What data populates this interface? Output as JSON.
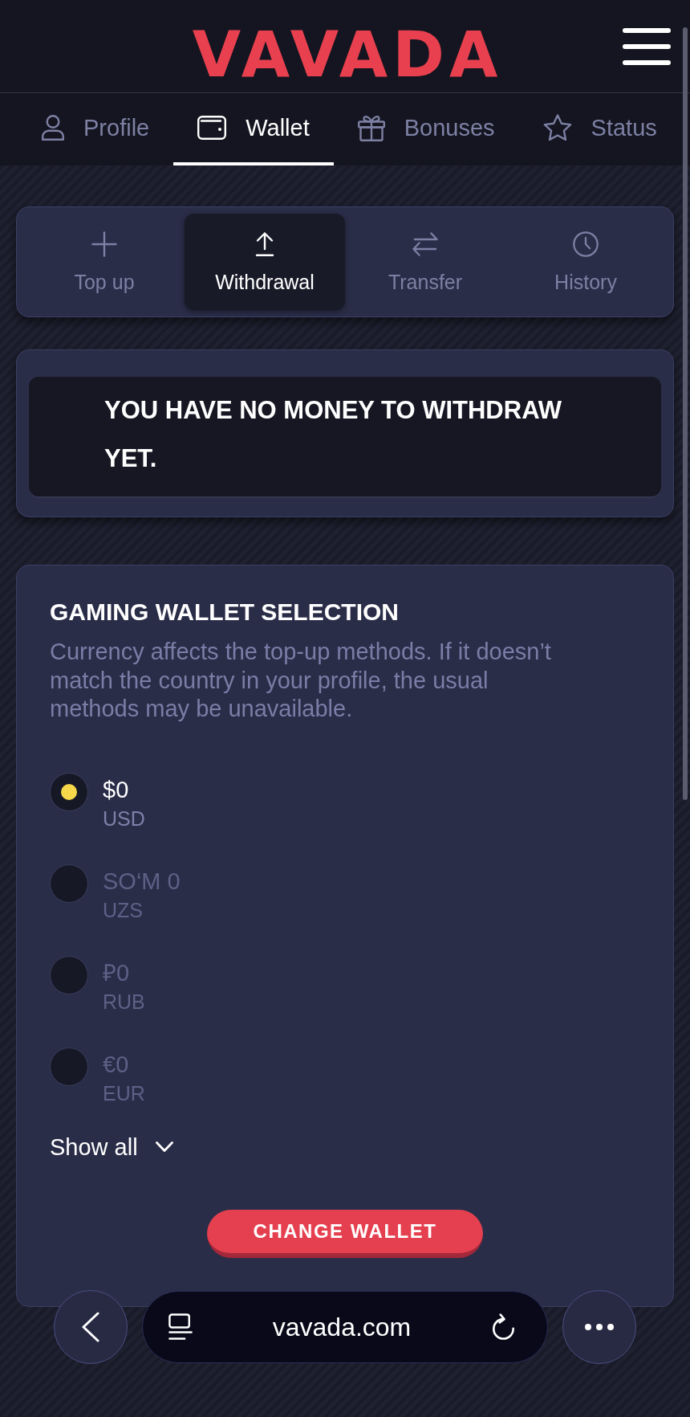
{
  "header": {
    "logo": "VAVADA"
  },
  "nav_tabs": [
    {
      "label": "Profile",
      "selected": false
    },
    {
      "label": "Wallet",
      "selected": true
    },
    {
      "label": "Bonuses",
      "selected": false
    },
    {
      "label": "Status",
      "selected": false
    }
  ],
  "wallet_actions": [
    {
      "label": "Top up",
      "selected": false
    },
    {
      "label": "Withdrawal",
      "selected": true
    },
    {
      "label": "Transfer",
      "selected": false
    },
    {
      "label": "History",
      "selected": false
    }
  ],
  "notice": {
    "message": "YOU HAVE NO MONEY TO WITHDRAW YET."
  },
  "wallet_selection": {
    "title": "GAMING WALLET SELECTION",
    "description": "Currency affects the top-up methods. If it doesn’t match the country in your profile, the usual methods may be unavailable.",
    "options": [
      {
        "amount": "$0",
        "currency": "USD",
        "selected": true
      },
      {
        "amount": "SO‘M 0",
        "currency": "UZS",
        "selected": false
      },
      {
        "amount": "₽0",
        "currency": "RUB",
        "selected": false
      },
      {
        "amount": "€0",
        "currency": "EUR",
        "selected": false
      }
    ],
    "show_all": "Show all",
    "button": "CHANGE WALLET"
  },
  "browser_bar": {
    "url": "vavada.com"
  }
}
